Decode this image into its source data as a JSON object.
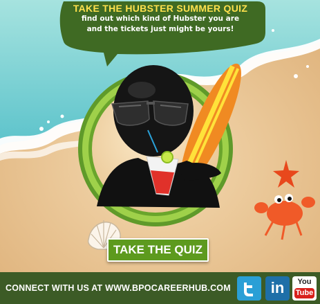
{
  "bubble": {
    "title": "TAKE THE HUBSTER SUMMER QUIZ",
    "line1": "find out which kind of Hubster you are",
    "line2": "and the tickets just might be yours!"
  },
  "cta": {
    "label": "TAKE THE QUIZ"
  },
  "footer": {
    "text": "CONNECT WITH US AT WWW.BPOCAREERHUB.COM",
    "social": [
      "twitter-icon",
      "linkedin-icon",
      "youtube-icon"
    ],
    "linkedin_text": "in",
    "youtube_you": "You",
    "youtube_tube": "Tube"
  },
  "colors": {
    "sea": "#7fd3d8",
    "sand": "#e9c79a",
    "bubble_green": "#3f6a23",
    "title_yellow": "#ffe14d",
    "button_green": "#5d9a1e",
    "footer_green": "#3c5b26",
    "ring_green": "#8dc63f"
  }
}
